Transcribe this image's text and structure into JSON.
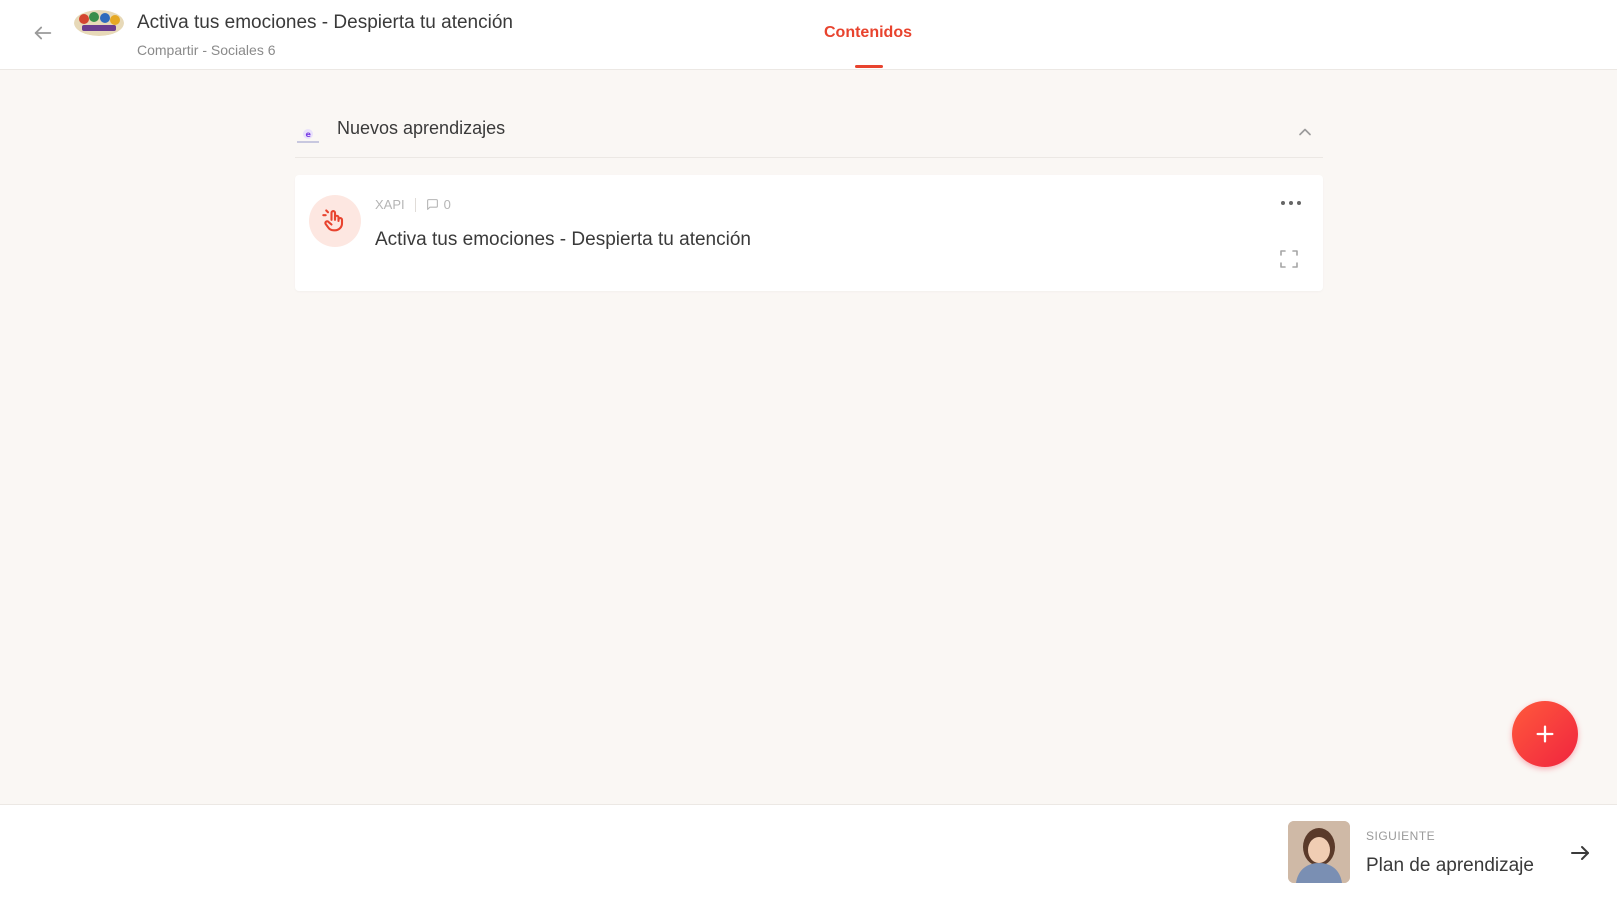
{
  "header": {
    "title": "Activa tus emociones - Despierta tu atención",
    "subtitle": "Compartir - Sociales 6",
    "tabs": [
      {
        "label": "Contenidos",
        "active": true
      }
    ],
    "accent_color": "#e8432e"
  },
  "section": {
    "title": "Nuevos aprendizajes",
    "items": [
      {
        "type": "XAPI",
        "comments": "0",
        "title": "Activa tus emociones - Despierta tu atención"
      }
    ]
  },
  "footer": {
    "next_eyebrow": "SIGUIENTE",
    "next_title": "Plan de aprendizaje"
  },
  "icons": {
    "back": "arrow-left-icon",
    "collapse": "chevron-up-icon",
    "item": "hand-pointer-icon",
    "comment": "comment-icon",
    "more": "more-horizontal-icon",
    "expand": "fullscreen-icon",
    "add": "plus-icon",
    "next": "arrow-right-icon"
  }
}
